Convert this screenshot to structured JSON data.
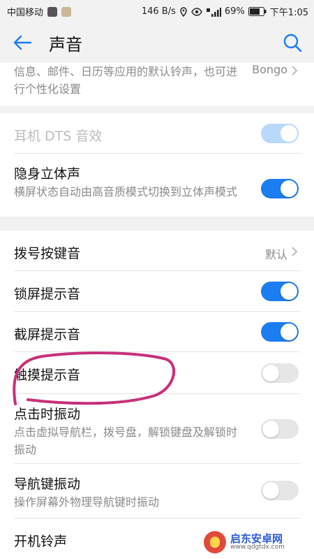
{
  "status_bar": {
    "carrier": "中国移动",
    "speed": "146 B/s",
    "battery": "69%",
    "time": "下午1:05"
  },
  "app_bar": {
    "title": "声音"
  },
  "rows": {
    "ringtone_desc": {
      "subtitle": "信息、邮件、日历等应用的默认铃声，也可进行个性化设置",
      "value": "Bongo"
    },
    "earphone_dts": {
      "title": "耳机 DTS 音效",
      "switch": "on",
      "disabled": true
    },
    "stealth_stereo": {
      "title": "隐身立体声",
      "subtitle": "横屏状态自动由高音质模式切换到立体声模式",
      "switch": "on"
    },
    "dial_keypad": {
      "title": "拨号按键音",
      "value": "默认"
    },
    "lock_screen": {
      "title": "锁屏提示音",
      "switch": "on"
    },
    "screenshot": {
      "title": "截屏提示音",
      "switch": "on"
    },
    "touch_sound": {
      "title": "触摸提示音",
      "switch": "off"
    },
    "tap_vibrate": {
      "title": "点击时振动",
      "subtitle": "点击虚拟导航栏，拨号盘，解锁键盘及解锁时振动",
      "switch": "off"
    },
    "nav_vibrate": {
      "title": "导航键振动",
      "subtitle": "操作屏幕外物理导航键时振动",
      "switch": "off"
    },
    "boot_ringtone": {
      "title": "开机铃声"
    }
  },
  "watermark": {
    "name": "启东安卓网",
    "url": "www.qdgtdx.com"
  },
  "colors": {
    "accent": "#1b7df0",
    "annotation": "#c8307a"
  }
}
